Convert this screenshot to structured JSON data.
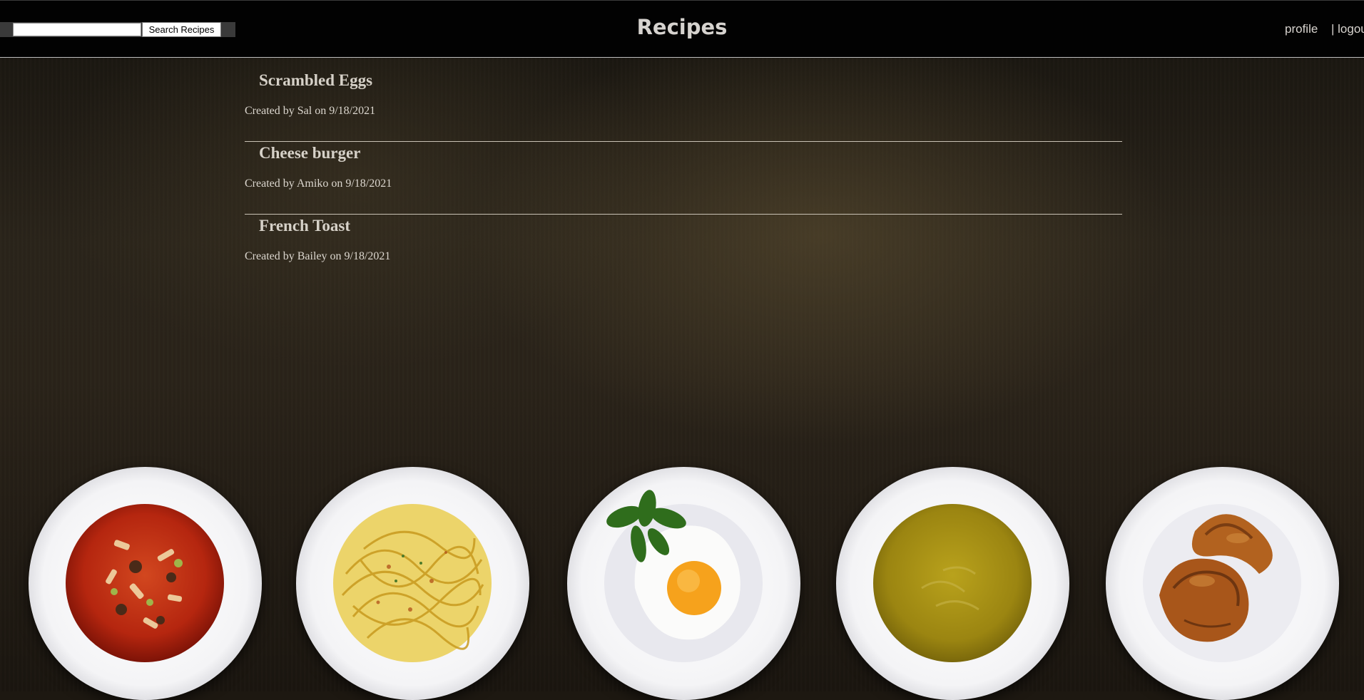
{
  "header": {
    "title": "Recipes",
    "search": {
      "value": "",
      "placeholder": "",
      "button_label": "Search Recipes"
    },
    "nav": {
      "profile_label": "profile",
      "logout_label": "| logout"
    }
  },
  "recipes": [
    {
      "title": "Scrambled Eggs",
      "meta": "Created by Sal on 9/18/2021"
    },
    {
      "title": "Cheese burger",
      "meta": "Created by Amiko on 9/18/2021"
    },
    {
      "title": "French Toast",
      "meta": "Created by Bailey on 9/18/2021"
    }
  ],
  "plates": [
    {
      "icon": "soup-bowl-image",
      "dish": "vegetable soup"
    },
    {
      "icon": "spaghetti-plate-image",
      "dish": "spaghetti"
    },
    {
      "icon": "fried-egg-plate-image",
      "dish": "fried egg with basil"
    },
    {
      "icon": "cream-soup-bowl-image",
      "dish": "cream soup"
    },
    {
      "icon": "croissant-plate-image",
      "dish": "croissants"
    }
  ],
  "colors": {
    "header_bg": "#020202",
    "title_text": "#d6d3cf",
    "body_text": "#dcd7cf",
    "divider": "#c9c2b5"
  }
}
